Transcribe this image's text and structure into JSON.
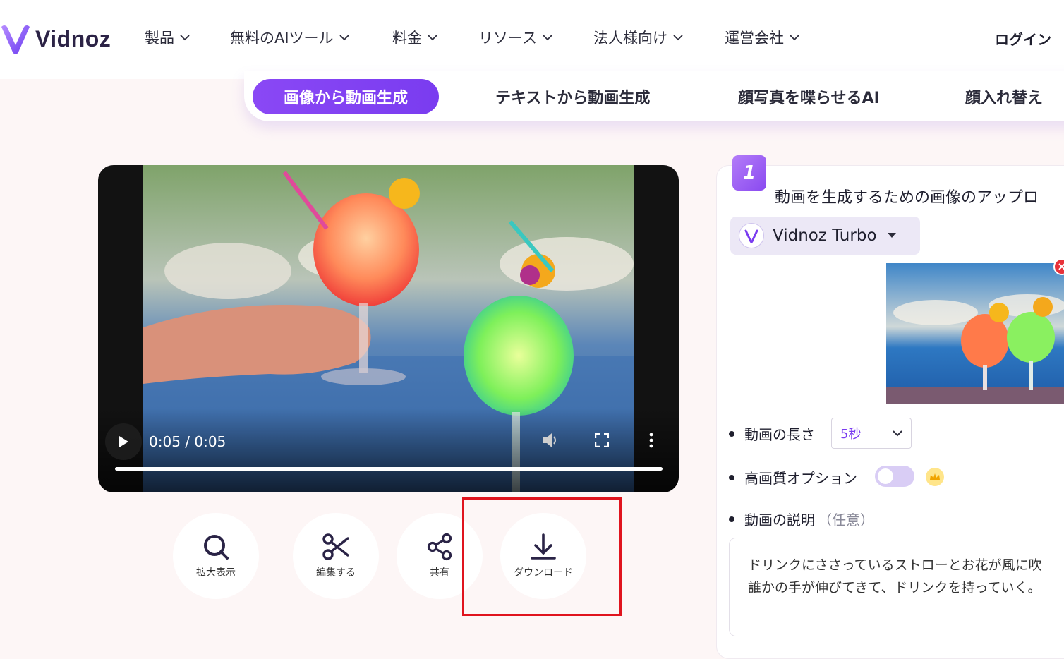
{
  "brand": {
    "name": "Vidnoz",
    "accent": "#7a3cf0"
  },
  "nav": {
    "items": [
      {
        "label": "製品"
      },
      {
        "label": "無料のAIツール"
      },
      {
        "label": "料金"
      },
      {
        "label": "リソース"
      },
      {
        "label": "法人様向け"
      },
      {
        "label": "運営会社"
      }
    ],
    "login": "ログイン"
  },
  "tabs": [
    {
      "label": "画像から動画生成",
      "active": true
    },
    {
      "label": "テキストから動画生成",
      "active": false
    },
    {
      "label": "顔写真を喋らせるAI",
      "active": false
    },
    {
      "label": "顔入れ替え",
      "active": false
    }
  ],
  "player": {
    "time": "0:05 / 0:05",
    "progress": 1.0,
    "icons": [
      "play-icon",
      "volume-icon",
      "fullscreen-icon",
      "more-vert-icon"
    ]
  },
  "actions": [
    {
      "label": "拡大表示",
      "icon": "search-icon"
    },
    {
      "label": "編集する",
      "icon": "scissors-icon"
    },
    {
      "label": "共有",
      "icon": "share-icon"
    },
    {
      "label": "ダウンロード",
      "icon": "download-icon"
    }
  ],
  "panel": {
    "step": "1",
    "title": "動画を生成するための画像のアップロ",
    "model": "Vidnoz Turbo",
    "duration": {
      "label": "動画の長さ",
      "value": "5秒"
    },
    "quality": {
      "label": "高画質オプション",
      "enabled": false
    },
    "description": {
      "label": "動画の説明",
      "hint": "（任意）",
      "line1": "ドリンクにささっているストローとお花が風に吹",
      "line2": "誰かの手が伸びてきて、ドリンクを持っていく。"
    }
  }
}
